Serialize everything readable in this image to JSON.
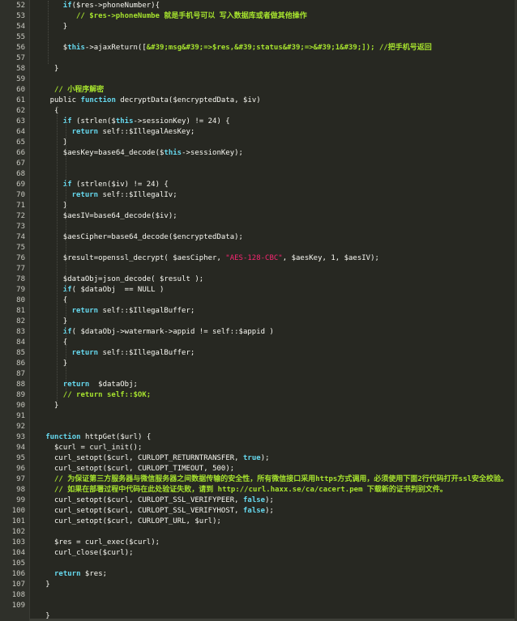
{
  "theme": {
    "background": "#272822",
    "gutter": "#2f302a",
    "line_number": "#c8c8c0",
    "plain": "#f8f8f2",
    "keyword": "#66d9ef",
    "string": "#f92672",
    "comment": "#a6e22e"
  },
  "lines": [
    {
      "n": "52",
      "indent": 7,
      "tokens": [
        [
          "kw",
          "if"
        ],
        [
          "plain",
          "($res->phoneNumber){"
        ]
      ]
    },
    {
      "n": "53",
      "indent": 10,
      "tokens": [
        [
          "cmt",
          "// $res->phoneNumbe 就是手机号可以 写入数据库或者做其他操作"
        ]
      ]
    },
    {
      "n": "54",
      "indent": 7,
      "tokens": [
        [
          "plain",
          "}"
        ]
      ]
    },
    {
      "n": "55",
      "indent": 0,
      "tokens": []
    },
    {
      "n": "56",
      "indent": 7,
      "tokens": [
        [
          "plain",
          "$"
        ],
        [
          "this",
          "this"
        ],
        [
          "plain",
          "->ajaxReturn(["
        ],
        [
          "cmt",
          "&#39;msg&#39;=>$res,&#39;status&#39;=>&#39;1&#39;]); //把手机号返回"
        ]
      ]
    },
    {
      "n": "57",
      "indent": 0,
      "tokens": []
    },
    {
      "n": "58",
      "indent": 5,
      "tokens": [
        [
          "plain",
          "}"
        ]
      ]
    },
    {
      "n": "59",
      "indent": 0,
      "tokens": []
    },
    {
      "n": "60",
      "indent": 5,
      "tokens": [
        [
          "cmt",
          "// 小程序解密"
        ]
      ]
    },
    {
      "n": "61",
      "indent": 4,
      "tokens": [
        [
          "plain",
          "public "
        ],
        [
          "kw",
          "function"
        ],
        [
          "plain",
          " decryptData($encryptedData, $iv)"
        ]
      ]
    },
    {
      "n": "62",
      "indent": 5,
      "tokens": [
        [
          "plain",
          "{"
        ]
      ]
    },
    {
      "n": "63",
      "indent": 7,
      "tokens": [
        [
          "kw",
          "if"
        ],
        [
          "plain",
          " (strlen($"
        ],
        [
          "this",
          "this"
        ],
        [
          "plain",
          "->sessionKey) != 24) {"
        ]
      ]
    },
    {
      "n": "64",
      "indent": 9,
      "tokens": [
        [
          "kw",
          "return"
        ],
        [
          "plain",
          " self::$IllegalAesKey;"
        ]
      ]
    },
    {
      "n": "65",
      "indent": 7,
      "tokens": [
        [
          "plain",
          "}"
        ]
      ]
    },
    {
      "n": "66",
      "indent": 7,
      "tokens": [
        [
          "plain",
          "$aesKey=base64_decode($"
        ],
        [
          "this",
          "this"
        ],
        [
          "plain",
          "->sessionKey);"
        ]
      ]
    },
    {
      "n": "67",
      "indent": 0,
      "tokens": []
    },
    {
      "n": "68",
      "indent": 0,
      "tokens": []
    },
    {
      "n": "69",
      "indent": 7,
      "tokens": [
        [
          "kw",
          "if"
        ],
        [
          "plain",
          " (strlen($iv) != 24) {"
        ]
      ]
    },
    {
      "n": "70",
      "indent": 9,
      "tokens": [
        [
          "kw",
          "return"
        ],
        [
          "plain",
          " self::$IllegalIv;"
        ]
      ]
    },
    {
      "n": "71",
      "indent": 7,
      "tokens": [
        [
          "plain",
          "}"
        ]
      ]
    },
    {
      "n": "72",
      "indent": 7,
      "tokens": [
        [
          "plain",
          "$aesIV=base64_decode($iv);"
        ]
      ]
    },
    {
      "n": "73",
      "indent": 0,
      "tokens": []
    },
    {
      "n": "74",
      "indent": 7,
      "tokens": [
        [
          "plain",
          "$aesCipher=base64_decode($encryptedData);"
        ]
      ]
    },
    {
      "n": "75",
      "indent": 0,
      "tokens": []
    },
    {
      "n": "76",
      "indent": 7,
      "tokens": [
        [
          "plain",
          "$result=openssl_decrypt( $aesCipher, "
        ],
        [
          "str",
          "\"AES-128-CBC\""
        ],
        [
          "plain",
          ", $aesKey, 1, $aesIV);"
        ]
      ]
    },
    {
      "n": "77",
      "indent": 0,
      "tokens": []
    },
    {
      "n": "78",
      "indent": 7,
      "tokens": [
        [
          "plain",
          "$dataObj=json_decode( $result );"
        ]
      ]
    },
    {
      "n": "79",
      "indent": 7,
      "tokens": [
        [
          "kw",
          "if"
        ],
        [
          "plain",
          "( $dataObj  == NULL )"
        ]
      ]
    },
    {
      "n": "80",
      "indent": 7,
      "tokens": [
        [
          "plain",
          "{"
        ]
      ]
    },
    {
      "n": "81",
      "indent": 9,
      "tokens": [
        [
          "kw",
          "return"
        ],
        [
          "plain",
          " self::$IllegalBuffer;"
        ]
      ]
    },
    {
      "n": "82",
      "indent": 7,
      "tokens": [
        [
          "plain",
          "}"
        ]
      ]
    },
    {
      "n": "83",
      "indent": 7,
      "tokens": [
        [
          "kw",
          "if"
        ],
        [
          "plain",
          "( $dataObj->watermark->appid != self::$appid )"
        ]
      ]
    },
    {
      "n": "84",
      "indent": 7,
      "tokens": [
        [
          "plain",
          "{"
        ]
      ]
    },
    {
      "n": "85",
      "indent": 9,
      "tokens": [
        [
          "kw",
          "return"
        ],
        [
          "plain",
          " self::$IllegalBuffer;"
        ]
      ]
    },
    {
      "n": "86",
      "indent": 7,
      "tokens": [
        [
          "plain",
          "}"
        ]
      ]
    },
    {
      "n": "87",
      "indent": 0,
      "tokens": []
    },
    {
      "n": "88",
      "indent": 7,
      "tokens": [
        [
          "kw",
          "return"
        ],
        [
          "plain",
          "  $dataObj;"
        ]
      ]
    },
    {
      "n": "89",
      "indent": 7,
      "tokens": [
        [
          "cmt",
          "// return self::$OK;"
        ]
      ]
    },
    {
      "n": "90",
      "indent": 5,
      "tokens": [
        [
          "plain",
          "}"
        ]
      ]
    },
    {
      "n": "91",
      "indent": 0,
      "tokens": []
    },
    {
      "n": "92",
      "indent": 0,
      "tokens": []
    },
    {
      "n": "93",
      "indent": 3,
      "tokens": [
        [
          "kw",
          "function"
        ],
        [
          "plain",
          " httpGet($url) {"
        ]
      ]
    },
    {
      "n": "94",
      "indent": 5,
      "tokens": [
        [
          "plain",
          "$curl = curl_init();"
        ]
      ]
    },
    {
      "n": "95",
      "indent": 5,
      "tokens": [
        [
          "plain",
          "curl_setopt($curl, CURLOPT_RETURNTRANSFER, "
        ],
        [
          "bool",
          "true"
        ],
        [
          "plain",
          ");"
        ]
      ]
    },
    {
      "n": "96",
      "indent": 5,
      "tokens": [
        [
          "plain",
          "curl_setopt($curl, CURLOPT_TIMEOUT, 500);"
        ]
      ]
    },
    {
      "n": "97",
      "indent": 5,
      "tokens": [
        [
          "cmt",
          "// 为保证第三方服务器与微信服务器之间数据传输的安全性，所有微信接口采用https方式调用，必须使用下面2行代码打开ssl安全校验。"
        ]
      ]
    },
    {
      "n": "98",
      "indent": 5,
      "tokens": [
        [
          "cmt",
          "// 如果在部署过程中代码在此处验证失败，请到 http://curl.haxx.se/ca/cacert.pem 下载新的证书判别文件。"
        ]
      ]
    },
    {
      "n": "99",
      "indent": 5,
      "tokens": [
        [
          "plain",
          "curl_setopt($curl, CURLOPT_SSL_VERIFYPEER, "
        ],
        [
          "bool",
          "false"
        ],
        [
          "plain",
          ");"
        ]
      ]
    },
    {
      "n": "100",
      "indent": 5,
      "tokens": [
        [
          "plain",
          "curl_setopt($curl, CURLOPT_SSL_VERIFYHOST, "
        ],
        [
          "bool",
          "false"
        ],
        [
          "plain",
          ");"
        ]
      ]
    },
    {
      "n": "101",
      "indent": 5,
      "tokens": [
        [
          "plain",
          "curl_setopt($curl, CURLOPT_URL, $url);"
        ]
      ]
    },
    {
      "n": "102",
      "indent": 0,
      "tokens": []
    },
    {
      "n": "103",
      "indent": 5,
      "tokens": [
        [
          "plain",
          "$res = curl_exec($curl);"
        ]
      ]
    },
    {
      "n": "104",
      "indent": 5,
      "tokens": [
        [
          "plain",
          "curl_close($curl);"
        ]
      ]
    },
    {
      "n": "105",
      "indent": 0,
      "tokens": []
    },
    {
      "n": "106",
      "indent": 5,
      "tokens": [
        [
          "kw",
          "return"
        ],
        [
          "plain",
          " $res;"
        ]
      ]
    },
    {
      "n": "107",
      "indent": 3,
      "tokens": [
        [
          "plain",
          "}"
        ]
      ]
    },
    {
      "n": "108",
      "indent": 0,
      "tokens": []
    },
    {
      "n": "109",
      "indent": 0,
      "tokens": []
    },
    {
      "n": "",
      "indent": 3,
      "tokens": [
        [
          "plain",
          "}"
        ]
      ]
    }
  ]
}
